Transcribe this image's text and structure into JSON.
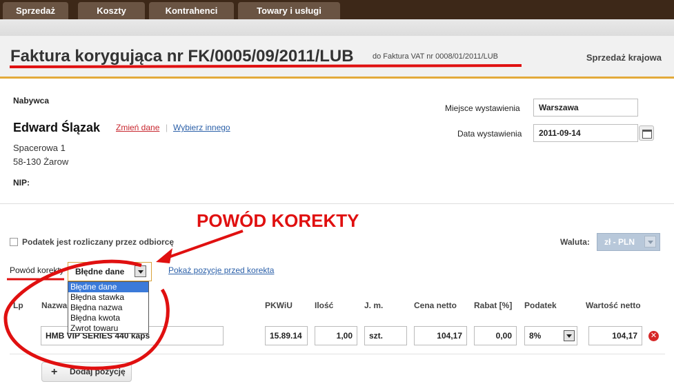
{
  "nav": {
    "tabs": [
      "Sprzedaż",
      "Koszty",
      "Kontrahenci",
      "Towary i usługi"
    ]
  },
  "header": {
    "title": "Faktura korygująca nr FK/0005/09/2011/LUB",
    "ref": "do Faktura VAT nr 0008/01/2011/LUB",
    "sale_type": "Sprzedaż krajowa"
  },
  "buyer": {
    "section_label": "Nabywca",
    "name": "Edward Ślązak",
    "change_link": "Zmień dane",
    "separator": "|",
    "choose_link": "Wybierz innego",
    "street": "Spacerowa 1",
    "city": "58-130 Żarow",
    "nip_label": "NIP:"
  },
  "issue": {
    "place_label": "Miejsce wystawienia",
    "place_value": "Warszawa",
    "date_label": "Data wystawienia",
    "date_value": "2011-09-14"
  },
  "annotation": "POWÓD KOREKTY",
  "options": {
    "tax_by_recipient": "Podatek jest rozliczany przez odbiorcę",
    "currency_label": "Waluta:",
    "currency_value": "zł - PLN",
    "reason_label": "Powód korekty",
    "reason_value": "Błędne dane",
    "reason_options": [
      "Błędne dane",
      "Błędna stawka",
      "Błędna nazwa",
      "Błędna kwota",
      "Zwrot towaru"
    ],
    "show_before_link": "Pokaż pozycje przed korekta"
  },
  "table": {
    "headers": {
      "lp": "Lp",
      "name": "Nazwa",
      "pkwiu": "PKWiU",
      "qty": "Ilość",
      "unit": "J. m.",
      "net_price": "Cena netto",
      "discount": "Rabat [%]",
      "tax": "Podatek",
      "net_value": "Wartość netto"
    },
    "row": {
      "name": "HMB VIP SERIES 440 kaps",
      "pkwiu": "15.89.14",
      "qty": "1,00",
      "unit": "szt.",
      "net_price": "104,17",
      "discount": "0,00",
      "tax": "8%",
      "net_value": "104,17"
    }
  },
  "add_button": "Dodaj pozycję",
  "colors": {
    "topbar": "#3d2818",
    "tab": "#6a5443",
    "accent": "#e3aa3a",
    "annotation": "#e01010",
    "link": "#2a5fa8"
  }
}
